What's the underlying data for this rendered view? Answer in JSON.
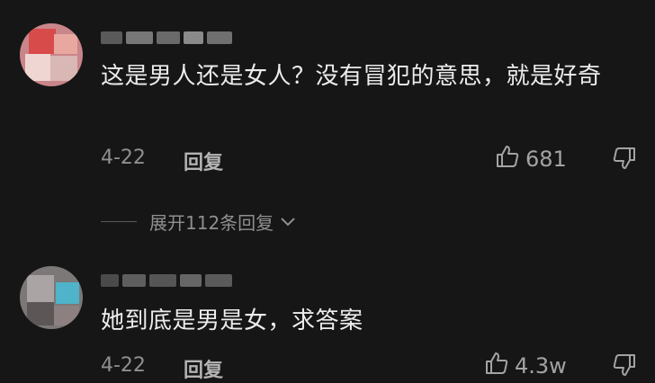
{
  "comments": [
    {
      "text": "这是男人还是女人？没有冒犯的意思，就是好奇",
      "date": "4-22",
      "reply_label": "回复",
      "likes": "681",
      "expand_label": "展开112条回复"
    },
    {
      "text": "她到底是男是女，求答案",
      "date": "4-22",
      "reply_label": "回复",
      "likes": "4.3w"
    }
  ]
}
